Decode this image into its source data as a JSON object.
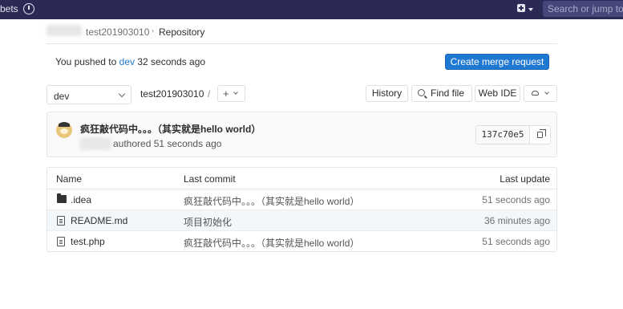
{
  "topbar": {
    "snippets_fragment": "bets",
    "search_placeholder": "Search or jump to"
  },
  "breadcrumb": {
    "project": "test201903010",
    "current": "Repository"
  },
  "push_notice": {
    "prefix": "You pushed to ",
    "branch": "dev",
    "suffix": " 32 seconds ago",
    "button": "Create merge request"
  },
  "toolbar": {
    "ref": "dev",
    "path_root": "test201903010",
    "path_sep": "/",
    "add_label": "+",
    "history": "History",
    "find_file": "Find file",
    "web_ide": "Web IDE"
  },
  "last_commit": {
    "title": "疯狂敲代码中。。。（其实就是hello world）",
    "authored": "authored 51 seconds ago",
    "sha": "137c70e5"
  },
  "tree": {
    "headers": {
      "name": "Name",
      "last_commit": "Last commit",
      "last_update": "Last update"
    },
    "rows": [
      {
        "type": "folder",
        "name": ".idea",
        "commit": "疯狂敲代码中。。。（其实就是hello world）",
        "updated": "51 seconds ago"
      },
      {
        "type": "file",
        "name": "README.md",
        "commit": "项目初始化",
        "updated": "36 minutes ago"
      },
      {
        "type": "file",
        "name": "test.php",
        "commit": "疯狂敲代码中。。。（其实就是hello world）",
        "updated": "51 seconds ago"
      }
    ]
  },
  "colors": {
    "navbar": "#2a2a54",
    "primary": "#1f78d1"
  }
}
